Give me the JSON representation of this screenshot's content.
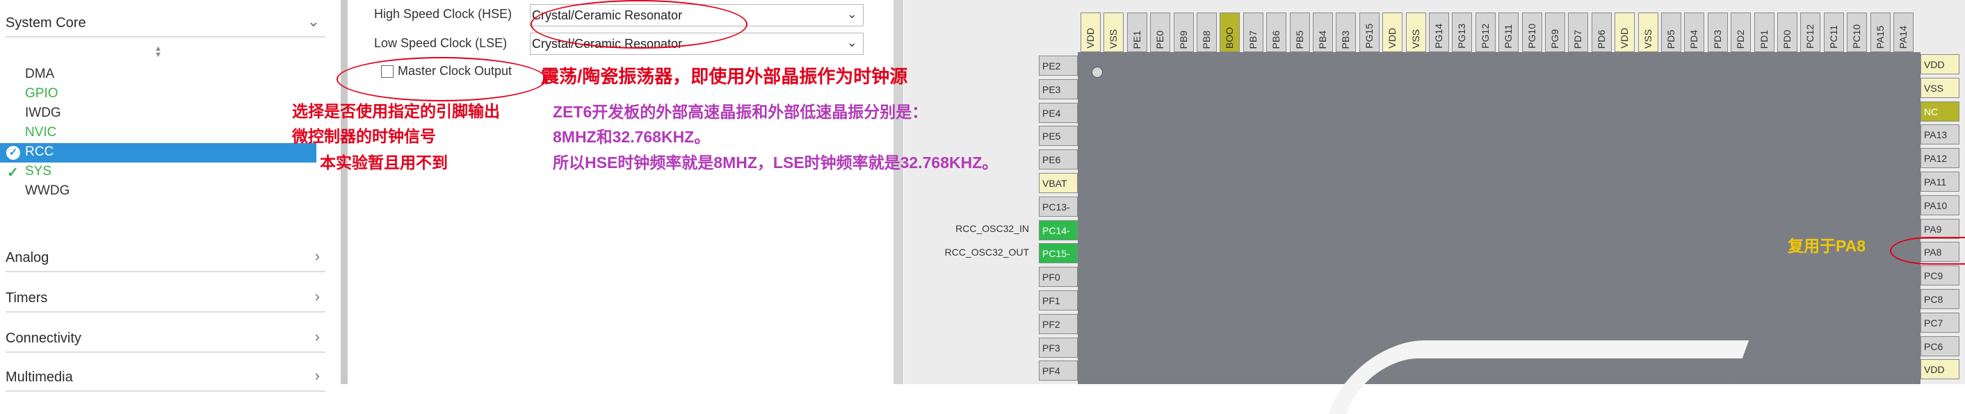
{
  "left_panel": {
    "system_core": "System Core",
    "items": [
      {
        "label": "DMA"
      },
      {
        "label": "GPIO"
      },
      {
        "label": "IWDG"
      },
      {
        "label": "NVIC"
      },
      {
        "label": "RCC"
      },
      {
        "label": "SYS"
      },
      {
        "label": "WWDG"
      }
    ],
    "categories": [
      "Analog",
      "Timers",
      "Connectivity",
      "Multimedia"
    ]
  },
  "rcc_config": {
    "hse_label": "High Speed Clock (HSE)",
    "hse_value": "Crystal/Ceramic Resonator",
    "lse_label": "Low Speed Clock (LSE)",
    "lse_value": "Crystal/Ceramic Resonator",
    "mco_label": "Master Clock Output"
  },
  "annotations": {
    "resonator_note": "震荡/陶瓷振荡器，即使用外部晶振作为时钟源",
    "mco_note_line1": "选择是否使用指定的引脚输出",
    "mco_note_line2": "微控制器的时钟信号",
    "mco_note_line3": "本实验暂且用不到",
    "crystal_note_line1": "ZET6开发板的外部高速晶振和外部低速晶振分别是：",
    "crystal_note_line2": "8MHZ和32.768KHZ。",
    "crystal_note_line3": "所以HSE时钟频率就是8MHZ，LSE时钟频率就是32.768KHZ。",
    "pa8_note": "复用于PA8"
  },
  "chip": {
    "top_pins": [
      {
        "name": "VDD",
        "type": "power"
      },
      {
        "name": "VSS",
        "type": "power"
      },
      {
        "name": "PE1"
      },
      {
        "name": "PE0"
      },
      {
        "name": "PB9"
      },
      {
        "name": "PB8"
      },
      {
        "name": "BOO",
        "type": "boot"
      },
      {
        "name": "PB7"
      },
      {
        "name": "PB6"
      },
      {
        "name": "PB5"
      },
      {
        "name": "PB4"
      },
      {
        "name": "PB3"
      },
      {
        "name": "PG15"
      },
      {
        "name": "VDD",
        "type": "power"
      },
      {
        "name": "VSS",
        "type": "power"
      },
      {
        "name": "PG14"
      },
      {
        "name": "PG13"
      },
      {
        "name": "PG12"
      },
      {
        "name": "PG11"
      },
      {
        "name": "PG10"
      },
      {
        "name": "PG9"
      },
      {
        "name": "PD7"
      },
      {
        "name": "PD6"
      },
      {
        "name": "VDD",
        "type": "power"
      },
      {
        "name": "VSS",
        "type": "power"
      },
      {
        "name": "PD5"
      },
      {
        "name": "PD4"
      },
      {
        "name": "PD3"
      },
      {
        "name": "PD2"
      },
      {
        "name": "PD1"
      },
      {
        "name": "PD0"
      },
      {
        "name": "PC12"
      },
      {
        "name": "PC11"
      },
      {
        "name": "PC10"
      },
      {
        "name": "PA15"
      },
      {
        "name": "PA14"
      }
    ],
    "left_pins": [
      {
        "name": "PE2"
      },
      {
        "name": "PE3"
      },
      {
        "name": "PE4"
      },
      {
        "name": "PE5"
      },
      {
        "name": "PE6"
      },
      {
        "name": "VBAT",
        "type": "power"
      },
      {
        "name": "PC13-"
      },
      {
        "name": "PC14-",
        "type": "active"
      },
      {
        "name": "PC15-",
        "type": "active"
      },
      {
        "name": "PF0"
      },
      {
        "name": "PF1"
      },
      {
        "name": "PF2"
      },
      {
        "name": "PF3"
      },
      {
        "name": "PF4"
      }
    ],
    "right_pins": [
      {
        "name": "VDD",
        "type": "power"
      },
      {
        "name": "VSS",
        "type": "power"
      },
      {
        "name": "NC",
        "type": "nc"
      },
      {
        "name": "PA13"
      },
      {
        "name": "PA12"
      },
      {
        "name": "PA11"
      },
      {
        "name": "PA10"
      },
      {
        "name": "PA9"
      },
      {
        "name": "PA8"
      },
      {
        "name": "PC9"
      },
      {
        "name": "PC8"
      },
      {
        "name": "PC7"
      },
      {
        "name": "PC6"
      },
      {
        "name": "VDD",
        "type": "power"
      }
    ],
    "signal_osc32_in": "RCC_OSC32_IN",
    "signal_osc32_out": "RCC_OSC32_OUT"
  }
}
